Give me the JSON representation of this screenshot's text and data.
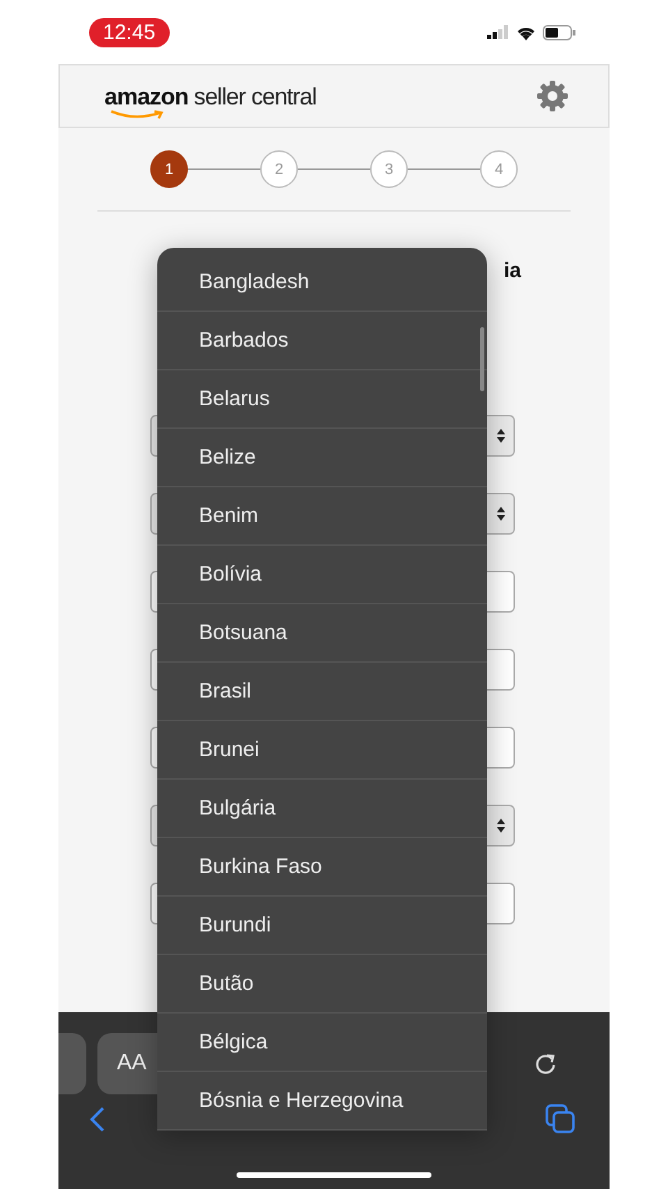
{
  "status_bar": {
    "time": "12:45"
  },
  "header": {
    "logo_brand": "amazon",
    "logo_product": "seller central"
  },
  "steps": [
    {
      "label": "1",
      "selected": true
    },
    {
      "label": "2",
      "selected": false
    },
    {
      "label": "3",
      "selected": false
    },
    {
      "label": "4",
      "selected": false
    }
  ],
  "form": {
    "heading_fragment": "ia",
    "fields": [
      {
        "kind": "select"
      },
      {
        "kind": "select"
      },
      {
        "kind": "input"
      },
      {
        "kind": "input"
      },
      {
        "kind": "input"
      },
      {
        "kind": "select"
      },
      {
        "kind": "input"
      }
    ]
  },
  "picker": {
    "options": [
      "Bangladesh",
      "Barbados",
      "Belarus",
      "Belize",
      "Benim",
      "Bolívia",
      "Botsuana",
      "Brasil",
      "Brunei",
      "Bulgária",
      "Burkina Faso",
      "Burundi",
      "Butão",
      "Bélgica",
      "Bósnia e Herzegovina"
    ]
  },
  "browser_toolbar": {
    "text_size_button": "AA"
  }
}
